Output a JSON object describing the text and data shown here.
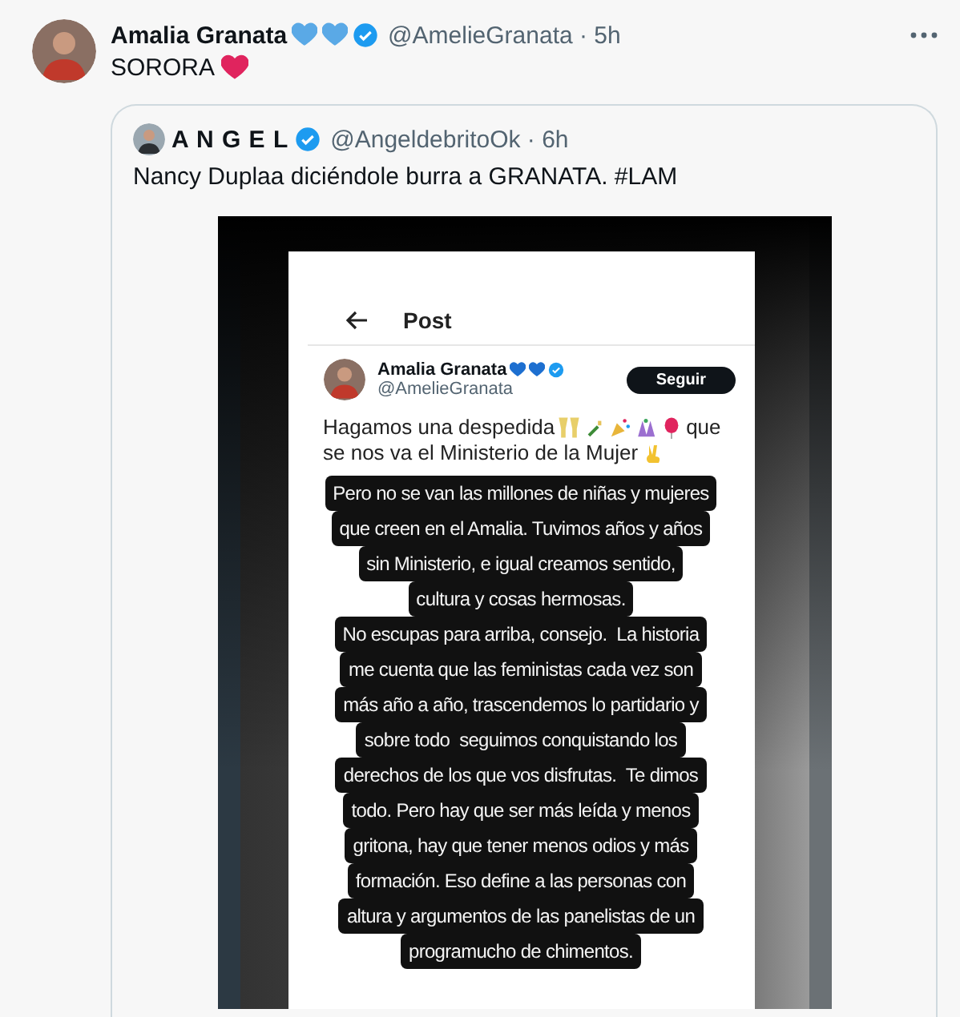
{
  "tweet": {
    "author": "Amalia Granata",
    "meta": "@AmelieGranata · 5h",
    "text": "SORORA",
    "quote": {
      "author": "A N G E L",
      "meta": "@AngeldebritoOk · 6h",
      "text": "Nancy Duplaa diciéndole burra a GRANATA. #LAM",
      "image": {
        "header": "Post",
        "author": "Amalia Granata",
        "handle": "@AmelieGranata",
        "follow_button": "Seguir",
        "text_line_1": "Hagamos una despedida",
        "text_line_1_end": "que",
        "text_line_2": "se nos va el Ministerio de la Mujer",
        "caption_lines": [
          "Pero no se van las millones de niñas y mujeres",
          "que creen en el Amalia. Tuvimos años y años",
          "sin Ministerio, e igual creamos sentido,",
          "cultura y cosas hermosas.",
          "No escupas para arriba, consejo.  La historia",
          "me cuenta que las feministas cada vez son",
          "más año a año, trascendemos lo partidario y",
          "sobre todo  seguimos conquistando los",
          "derechos de los que vos disfrutas.  Te dimos",
          "todo. Pero hay que ser más leída y menos",
          "gritona, hay que tener menos odios y más",
          "formación. Eso define a las personas con",
          "altura y argumentos de las panelistas de un",
          "programucho de chimentos."
        ]
      }
    }
  }
}
